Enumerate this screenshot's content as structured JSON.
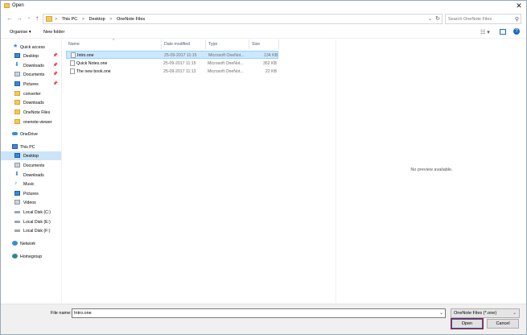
{
  "window": {
    "title": "Open"
  },
  "address": {
    "crumbs": [
      "This PC",
      "Desktop",
      "OneNote Files"
    ],
    "separator": ">"
  },
  "search": {
    "placeholder": "Search OneNote Files"
  },
  "toolbar": {
    "organise": "Organise ▾",
    "new_folder": "New folder"
  },
  "sidebar": {
    "items": [
      {
        "label": "Quick access",
        "icon": "star-icon",
        "pinned": false
      },
      {
        "label": "Desktop",
        "icon": "desktop-icon",
        "pinned": true
      },
      {
        "label": "Downloads",
        "icon": "downloads-icon",
        "pinned": true
      },
      {
        "label": "Documents",
        "icon": "documents-icon",
        "pinned": true
      },
      {
        "label": "Pictures",
        "icon": "pictures-icon",
        "pinned": true
      },
      {
        "label": "converter",
        "icon": "folder-icon",
        "pinned": false
      },
      {
        "label": "Downloads",
        "icon": "folder-icon",
        "pinned": false
      },
      {
        "label": "OneNote Files",
        "icon": "folder-icon",
        "pinned": false
      },
      {
        "label": "onenote-viewer",
        "icon": "folder-icon",
        "pinned": false
      },
      {
        "label": "OneDrive",
        "icon": "onedrive-icon",
        "pinned": false
      },
      {
        "label": "This PC",
        "icon": "this-pc-icon",
        "pinned": false
      },
      {
        "label": "Desktop",
        "icon": "desktop-icon",
        "pinned": false,
        "selected": true
      },
      {
        "label": "Documents",
        "icon": "documents-icon",
        "pinned": false
      },
      {
        "label": "Downloads",
        "icon": "downloads-icon",
        "pinned": false
      },
      {
        "label": "Music",
        "icon": "music-icon",
        "pinned": false
      },
      {
        "label": "Pictures",
        "icon": "pictures-icon",
        "pinned": false
      },
      {
        "label": "Videos",
        "icon": "videos-icon",
        "pinned": false
      },
      {
        "label": "Local Disk (C:)",
        "icon": "drive-icon",
        "pinned": false
      },
      {
        "label": "Local Disk (E:)",
        "icon": "drive-icon",
        "pinned": false
      },
      {
        "label": "Local Disk (F:)",
        "icon": "drive-icon",
        "pinned": false
      },
      {
        "label": "Network",
        "icon": "network-icon",
        "pinned": false
      },
      {
        "label": "Homegroup",
        "icon": "homegroup-icon",
        "pinned": false
      }
    ]
  },
  "columns": {
    "name": "Name",
    "date": "Date modified",
    "type": "Type",
    "size": "Size"
  },
  "files": [
    {
      "name": "Intro.one",
      "date": "25-09-2017 11:15",
      "type": "Microsoft OneNot...",
      "size": "134 KB",
      "selected": true
    },
    {
      "name": "Quick Notes.one",
      "date": "25-09-2017 11:15",
      "type": "Microsoft OneNot...",
      "size": "352 KB",
      "selected": false
    },
    {
      "name": "The new book.one",
      "date": "25-09-2017 11:13",
      "type": "Microsoft OneNot...",
      "size": "22 KB",
      "selected": false
    }
  ],
  "preview": {
    "message": "No preview available."
  },
  "footer": {
    "file_name_label": "File name:",
    "file_name_value": "Intro.one",
    "file_type": "OneNote Files (*.one)",
    "open_label": "Open",
    "cancel_label": "Cancel"
  }
}
